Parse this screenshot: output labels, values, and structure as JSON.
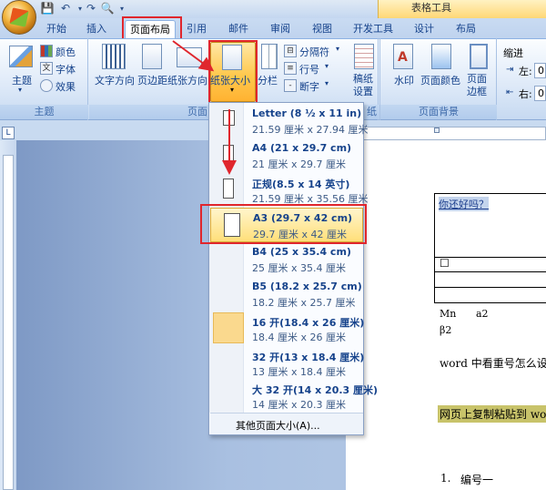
{
  "titlebar": {
    "table_tools": "表格工具"
  },
  "tabs": [
    "开始",
    "插入",
    "页面布局",
    "引用",
    "邮件",
    "审阅",
    "视图",
    "开发工具",
    "设计",
    "布局"
  ],
  "ribbon": {
    "theme_group": {
      "label": "主题",
      "theme": "主题",
      "colors": "颜色",
      "fonts": "字体",
      "effects": "效果"
    },
    "page_setup": {
      "label": "页面",
      "text_direction": "文字方向",
      "margins": "页边距",
      "orientation": "纸张方向",
      "size": "纸张大小",
      "columns": "分栏",
      "breaks": "分隔符",
      "line_numbers": "行号",
      "hyphenation": "断字"
    },
    "manuscript": {
      "label": "纸",
      "btn": "稿纸\n设置"
    },
    "background": {
      "label": "页面背景",
      "watermark": "水印",
      "page_color": "页面颜色",
      "page_borders": "页面\n边框"
    },
    "indent": {
      "title": "缩进",
      "left_label": "左:",
      "left_value": "0",
      "right_label": "右:",
      "right_value": "0"
    }
  },
  "size_menu": [
    {
      "name": "Letter (8 ½ x 11 in)",
      "dims": "21.59 厘米 x 27.94 厘米"
    },
    {
      "name": "A4 (21 x 29.7 cm)",
      "dims": "21 厘米 x 29.7 厘米"
    },
    {
      "name": "正规(8.5 x 14 英寸)",
      "dims": "21.59 厘米 x 35.56 厘米"
    },
    {
      "name": "A3 (29.7 x 42 cm)",
      "dims": "29.7 厘米 x 42 厘米"
    },
    {
      "name": "B4 (25 x 35.4 cm)",
      "dims": "25 厘米 x 35.4 厘米"
    },
    {
      "name": "B5 (18.2 x 25.7 cm)",
      "dims": "18.2 厘米 x 25.7 厘米"
    },
    {
      "name": "16 开(18.4 x 26 厘米)",
      "dims": "18.4 厘米 x 26 厘米"
    },
    {
      "name": "32 开(13 x 18.4 厘米)",
      "dims": "13 厘米 x 18.4 厘米"
    },
    {
      "name": "大 32 开(14 x 20.3 厘米)",
      "dims": "14 厘米 x 20.3 厘米"
    }
  ],
  "size_menu_more": "其他页面大小(A)...",
  "document": {
    "cell_text": "你还好吗？",
    "checkbox": "☐",
    "mn": "Mn",
    "a2": "a2",
    "beta": "β2",
    "para1": "word 中看重号怎么设置",
    "para2": "网页上复制粘贴到 word",
    "list_num": "1.",
    "list_text": "编号一"
  }
}
